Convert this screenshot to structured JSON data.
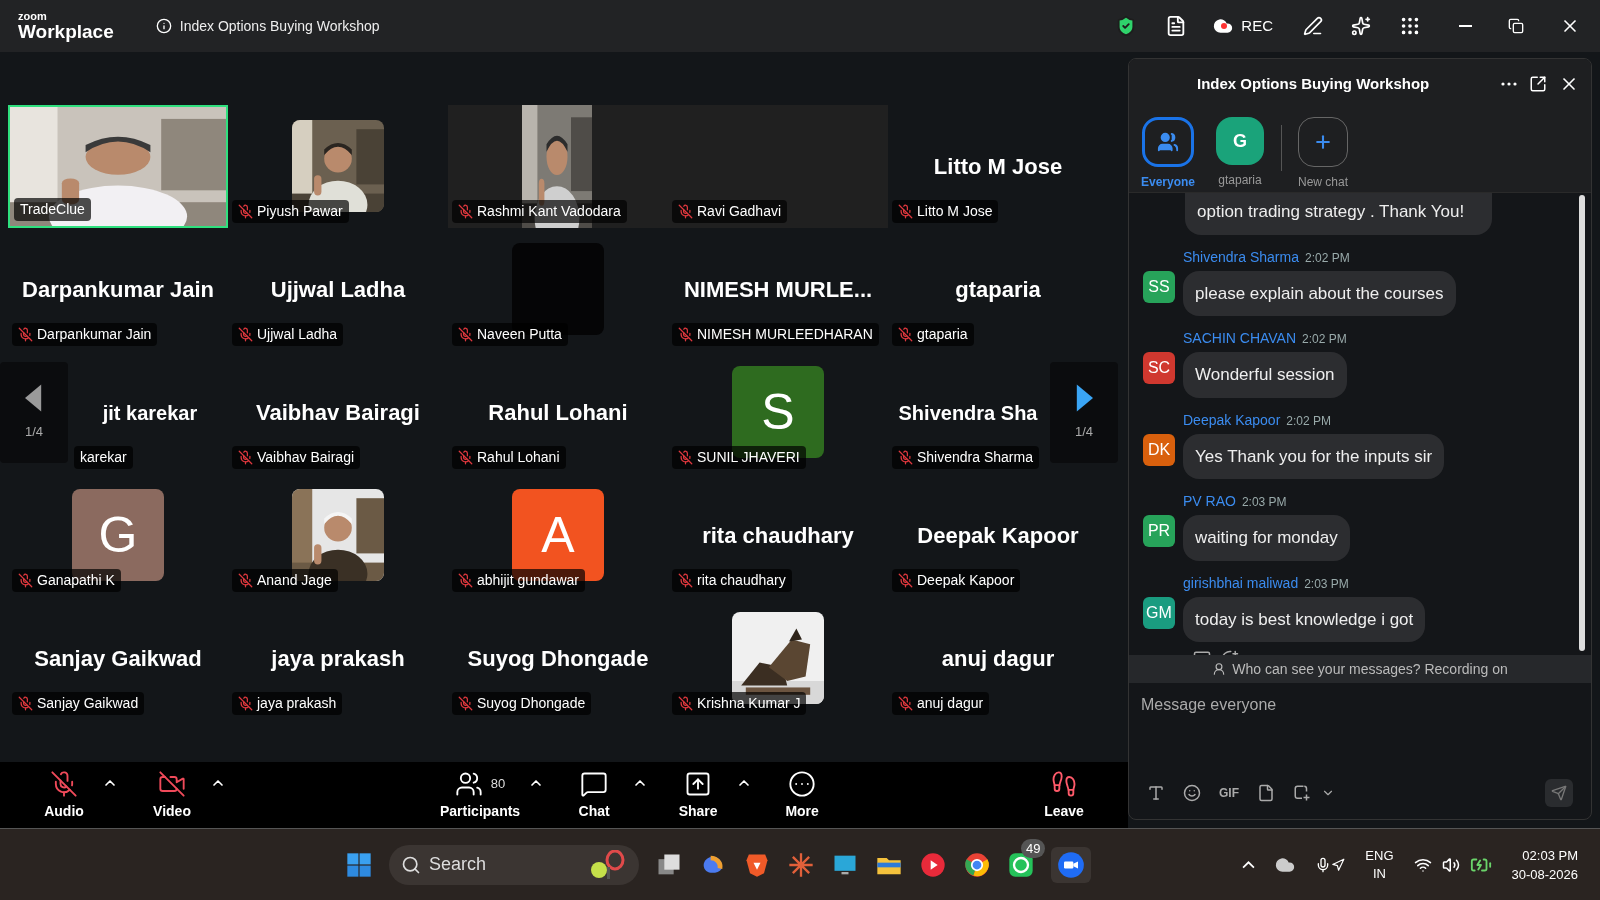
{
  "top_bar": {
    "logo_small": "zoom",
    "logo_large": "Workplace",
    "meeting_title": "Index Options Buying Workshop",
    "rec_label": "REC"
  },
  "tiles": [
    {
      "kind": "video",
      "name": "TradeClue",
      "muted": false,
      "speaking": true
    },
    {
      "name": "Piyush Pawar",
      "muted": true,
      "speaking": false
    },
    {
      "kind": "portrait-video",
      "name": "Rashmi Kant Vadodara",
      "muted": true,
      "speaking": false
    },
    {
      "kind": "no-video",
      "name": "Ravi Gadhavi",
      "muted": true,
      "speaking": false
    },
    {
      "kind": "name",
      "display": "Litto M Jose",
      "name": "Litto M Jose",
      "muted": true,
      "speaking": false
    },
    {
      "kind": "name",
      "display": "Darpankumar Jain",
      "name": "Darpankumar Jain",
      "muted": true,
      "speaking": false
    },
    {
      "kind": "name",
      "display": "Ujjwal Ladha",
      "name": "Ujjwal Ladha",
      "muted": true,
      "speaking": false
    },
    {
      "kind": "blank",
      "name": "Naveen Putta",
      "muted": true,
      "speaking": false
    },
    {
      "kind": "name",
      "display": "NIMESH MURLE...",
      "name": "NIMESH MURLEEDHARAN",
      "muted": true,
      "speaking": false
    },
    {
      "kind": "name",
      "display": "gtaparia",
      "name": "gtaparia",
      "muted": true,
      "speaking": false
    },
    {
      "kind": "name",
      "display": "jit karekar",
      "name": "karekar",
      "muted": false,
      "speaking": false,
      "partly_hidden": true
    },
    {
      "kind": "name",
      "display": "Vaibhav Bairagi",
      "name": "Vaibhav Bairagi",
      "muted": true,
      "speaking": false
    },
    {
      "kind": "name",
      "display": "Rahul Lohani",
      "name": "Rahul Lohani",
      "muted": true,
      "speaking": false
    },
    {
      "kind": "avatar",
      "initial": "S",
      "color": "#2e6b1f",
      "name": "SUNIL JHAVERI",
      "muted": true,
      "speaking": false
    },
    {
      "kind": "name",
      "display": "Shivendra Sha",
      "name": "Shivendra Sharma",
      "muted": true,
      "speaking": false,
      "partly_hidden": true
    },
    {
      "kind": "avatar",
      "initial": "G",
      "color": "#8b6a5f",
      "name": "Ganapathi K",
      "muted": true,
      "speaking": false
    },
    {
      "name": "Anand Jage",
      "muted": true,
      "speaking": false
    },
    {
      "kind": "avatar",
      "initial": "A",
      "color": "#f25320",
      "name": "abhijit gundawar",
      "muted": true,
      "speaking": false
    },
    {
      "kind": "name",
      "display": "rita chaudhary",
      "name": "rita chaudhary",
      "muted": true,
      "speaking": false
    },
    {
      "kind": "name",
      "display": "Deepak Kapoor",
      "name": "Deepak Kapoor",
      "muted": true,
      "speaking": false
    },
    {
      "kind": "name",
      "display": "Sanjay Gaikwad",
      "name": "Sanjay Gaikwad",
      "muted": true,
      "speaking": false
    },
    {
      "kind": "name",
      "display": "jaya prakash",
      "name": "jaya prakash",
      "muted": true,
      "speaking": false
    },
    {
      "kind": "name",
      "display": "Suyog Dhongade",
      "name": "Suyog Dhongade",
      "muted": true,
      "speaking": false
    },
    {
      "name": "Krishna Kumar J",
      "muted": true,
      "speaking": false
    },
    {
      "kind": "name",
      "display": "anuj dagur",
      "name": "anuj dagur",
      "muted": true,
      "speaking": false
    }
  ],
  "pager": {
    "left": "1/4",
    "right": "1/4"
  },
  "toolbar": [
    {
      "kind": "audio",
      "label": "Audio",
      "off": true,
      "menu": true
    },
    {
      "kind": "video",
      "label": "Video",
      "off": true,
      "menu": true
    },
    {
      "kind": "participants",
      "label": "Participants",
      "count": "80",
      "menu": true
    },
    {
      "kind": "chat",
      "label": "Chat",
      "menu": true
    },
    {
      "kind": "share",
      "label": "Share",
      "menu": true
    },
    {
      "kind": "more",
      "label": "More",
      "menu": false
    },
    {
      "kind": "leave",
      "label": "Leave",
      "menu": false
    }
  ],
  "chat": {
    "title": "Index Options Buying Workshop",
    "tabs": [
      {
        "kind": "everyone",
        "label": "Everyone",
        "selected": true
      },
      {
        "kind": "person",
        "label": "gtaparia",
        "initial": "G",
        "color": "#1aa37a",
        "selected": false
      },
      {
        "kind": "new",
        "label": "New chat",
        "selected": false
      }
    ],
    "partial_message": "option trading strategy . Thank You!",
    "messages": [
      {
        "sender": "Shivendra Sharma",
        "time": "2:02 PM",
        "initials": "SS",
        "color": "#27a35a",
        "text": "please explain about the courses"
      },
      {
        "sender": "SACHIN CHAVAN",
        "time": "2:02 PM",
        "initials": "SC",
        "color": "#d0382f",
        "text": "Wonderful session"
      },
      {
        "sender": "Deepak Kapoor",
        "time": "2:02 PM",
        "initials": "DK",
        "color": "#d9600d",
        "text": "Yes Thank you for the inputs sir"
      },
      {
        "sender": "PV RAO",
        "time": "2:03 PM",
        "initials": "PR",
        "color": "#27a35a",
        "text": "waiting for monday"
      },
      {
        "sender": "girishbhai maliwad",
        "time": "2:03 PM",
        "initials": "GM",
        "color": "#1a9c80",
        "text": "today is best knowledge i got"
      }
    ],
    "notice": "Who can see your messages? Recording on",
    "placeholder": "Message everyone",
    "gif_label": "GIF"
  },
  "taskbar": {
    "search_placeholder": "Search",
    "badge": "49",
    "lang_top": "ENG",
    "lang_bottom": "IN",
    "time": "02:03 PM",
    "date": "30-08-2026"
  }
}
